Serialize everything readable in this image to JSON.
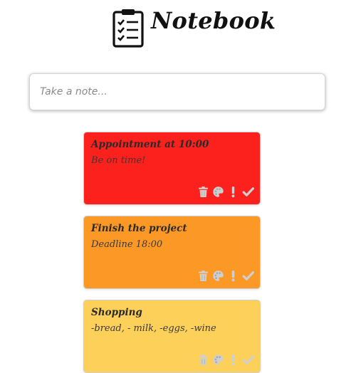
{
  "header": {
    "title": "Notebook",
    "icon": "clipboard-checklist-icon"
  },
  "composer": {
    "placeholder": "Take a note..."
  },
  "notes": [
    {
      "title": "Appointment at 10:00",
      "body": "Be on time!",
      "color": "#fc211d",
      "actions": [
        "trash-icon",
        "palette-icon",
        "exclamation-icon",
        "check-icon"
      ]
    },
    {
      "title": "Finish the project",
      "body": "Deadline 18:00",
      "color": "#fc9826",
      "actions": [
        "trash-icon",
        "palette-icon",
        "exclamation-icon",
        "check-icon"
      ]
    },
    {
      "title": "Shopping",
      "body": "-bread, - milk, -eggs, -wine",
      "color": "#fdd05a",
      "actions": [
        "trash-icon",
        "palette-icon",
        "exclamation-icon",
        "check-icon"
      ]
    }
  ],
  "colors": {
    "action_icon": "#cfcfcf"
  }
}
